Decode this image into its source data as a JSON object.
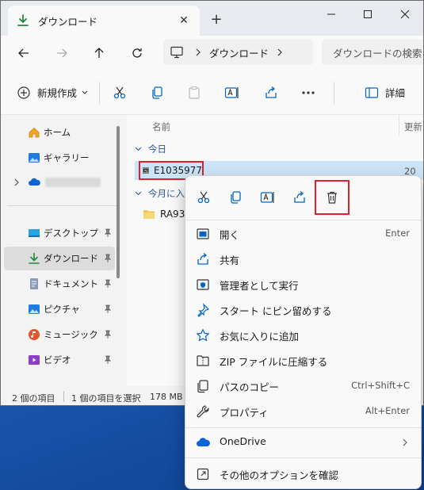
{
  "tab": {
    "title": "ダウンロード",
    "close": "✕",
    "new_tab": "+"
  },
  "address": {
    "crumb": "ダウンロード",
    "search_placeholder": "ダウンロードの検索"
  },
  "toolbar": {
    "new_label": "新規作成",
    "detail_label": "詳細"
  },
  "sidebar": {
    "home": "ホーム",
    "gallery": "ギャラリー",
    "onedrive_blurred": "",
    "desktop": "デスクトップ",
    "downloads": "ダウンロード",
    "documents": "ドキュメント",
    "pictures": "ピクチャ",
    "music": "ミュージック",
    "videos": "ビデオ"
  },
  "files": {
    "header_name": "名前",
    "header_date": "更新",
    "group_today": "今日",
    "selected_file": "E1035977",
    "selected_date": "20",
    "group_month": "今月に入っ",
    "other_file": "RA937"
  },
  "status": {
    "count": "2 個の項目",
    "selected": "1 個の項目を選択",
    "size": "178 MB"
  },
  "context_menu": {
    "items": [
      {
        "label": "開く",
        "shortcut": "Enter"
      },
      {
        "label": "共有",
        "shortcut": ""
      },
      {
        "label": "管理者として実行",
        "shortcut": ""
      },
      {
        "label": "スタート にピン留めする",
        "shortcut": ""
      },
      {
        "label": "お気に入りに追加",
        "shortcut": ""
      },
      {
        "label": "ZIP ファイルに圧縮する",
        "shortcut": ""
      },
      {
        "label": "パスのコピー",
        "shortcut": "Ctrl+Shift+C"
      },
      {
        "label": "プロパティ",
        "shortcut": "Alt+Enter"
      }
    ],
    "onedrive": "OneDrive",
    "more_options": "その他のオプションを確認"
  },
  "colors": {
    "accent": "#0067c0",
    "highlight_border": "#e0202e",
    "selection": "#cce4f7"
  }
}
